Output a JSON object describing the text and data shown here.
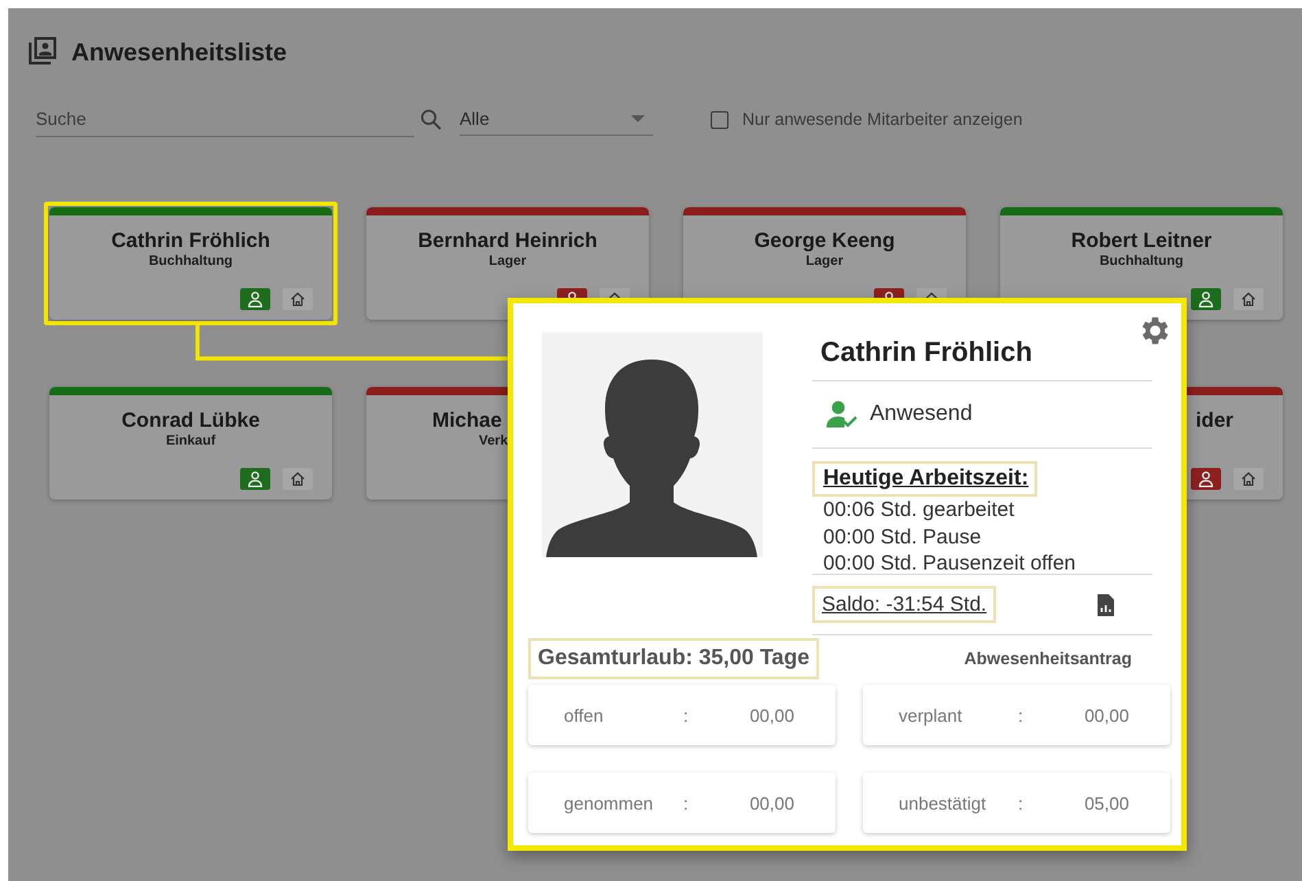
{
  "header": {
    "title": "Anwesenheitsliste"
  },
  "filters": {
    "search": {
      "placeholder": "Suche"
    },
    "department": {
      "value": "Alle"
    },
    "present_only": {
      "label": "Nur anwesende Mitarbeiter anzeigen",
      "checked": false
    }
  },
  "employees": [
    {
      "name": "Cathrin Fröhlich",
      "department": "Buchhaltung",
      "present": true,
      "highlighted": true,
      "buttons": true,
      "clipped_left": false,
      "clipped_right": false
    },
    {
      "name": "Bernhard Heinrich",
      "department": "Lager",
      "present": false,
      "highlighted": false,
      "buttons": true,
      "clipped_left": false,
      "clipped_right": false
    },
    {
      "name": "George Keeng",
      "department": "Lager",
      "present": false,
      "highlighted": false,
      "buttons": true,
      "clipped_left": false,
      "clipped_right": false
    },
    {
      "name": "Robert Leitner",
      "department": "Buchhaltung",
      "present": true,
      "highlighted": false,
      "buttons": true,
      "clipped_left": false,
      "clipped_right": false
    },
    {
      "name": "Conrad Lübke",
      "department": "Einkauf",
      "present": true,
      "highlighted": false,
      "buttons": true,
      "clipped_left": false,
      "clipped_right": false
    },
    {
      "name": "Michae",
      "department": "Verk",
      "present": false,
      "highlighted": false,
      "buttons": false,
      "clipped_left": false,
      "clipped_right": true
    },
    {
      "name": "ider",
      "present": false,
      "highlighted": false,
      "buttons": true,
      "clipped_left": true,
      "clipped_right": false
    }
  ],
  "detail": {
    "name": "Cathrin Fröhlich",
    "status": {
      "label": "Anwesend",
      "present": true
    },
    "worktime": {
      "heading": "Heutige Arbeitszeit:",
      "marked": true,
      "lines": [
        "00:06 Std. gearbeitet",
        "00:00 Std. Pause",
        "00:00 Std. Pausenzeit offen"
      ]
    },
    "balance": {
      "text": "Saldo: -31:54 Std.",
      "marked": true
    },
    "vacation_total": {
      "text": "Gesamturlaub: 35,00 Tage",
      "marked": true
    },
    "absence_request": "Abwesenheitsantrag",
    "vacation": [
      {
        "label": "offen",
        "separator": ":",
        "value": "00,00"
      },
      {
        "label": "verplant",
        "separator": ":",
        "value": "00,00"
      },
      {
        "label": "genommen",
        "separator": ":",
        "value": "00,00"
      },
      {
        "label": "unbestätigt",
        "separator": ":",
        "value": "05,00"
      }
    ]
  }
}
